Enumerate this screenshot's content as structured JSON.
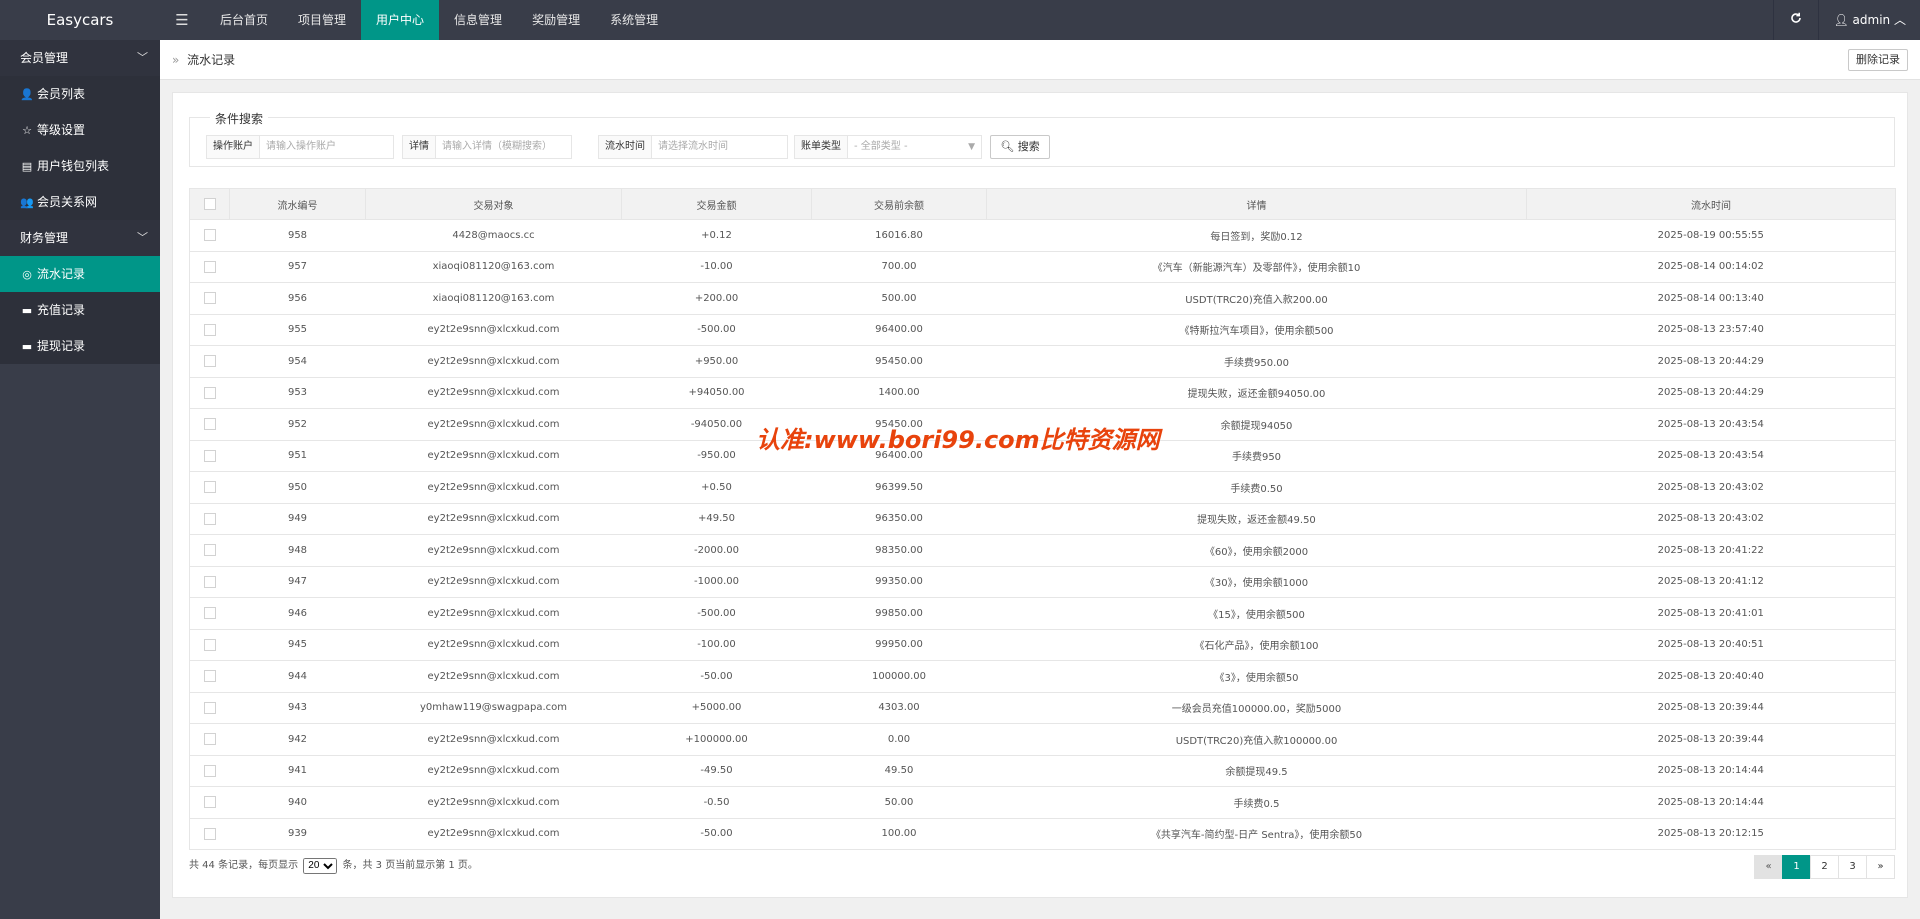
{
  "app": {
    "title": "Easycars",
    "menu_icon": "☰"
  },
  "topnav": {
    "items": [
      {
        "label": "后台首页",
        "active": false
      },
      {
        "label": "项目管理",
        "active": false
      },
      {
        "label": "用户中心",
        "active": true
      },
      {
        "label": "信息管理",
        "active": false
      },
      {
        "label": "奖励管理",
        "active": false
      },
      {
        "label": "系统管理",
        "active": false
      }
    ]
  },
  "topright": {
    "refresh_icon": "refresh-icon",
    "user": "admin"
  },
  "sidebar": {
    "group1": {
      "label": "会员管理"
    },
    "group1_items": [
      {
        "label": "会员列表",
        "icon": "👤"
      },
      {
        "label": "等级设置",
        "icon": "☆"
      },
      {
        "label": "用户钱包列表",
        "icon": "▤"
      },
      {
        "label": "会员关系网",
        "icon": "👥"
      }
    ],
    "group2": {
      "label": "财务管理"
    },
    "group2_items": [
      {
        "label": "流水记录",
        "icon": "◎",
        "active": true
      },
      {
        "label": "充值记录",
        "icon": "▬"
      },
      {
        "label": "提现记录",
        "icon": "▬"
      }
    ]
  },
  "breadcrumb": {
    "arrow": "»",
    "current": "流水记录"
  },
  "actions": {
    "delete_label": "删除记录"
  },
  "search": {
    "legend": "条件搜索",
    "account_label": "操作账户",
    "account_placeholder": "请输入操作账户",
    "detail_label": "详情",
    "detail_placeholder": "请输入详情（模糊搜索）",
    "time_label": "流水时间",
    "time_placeholder": "请选择流水时间",
    "type_label": "账单类型",
    "type_value": "- 全部类型 -",
    "button_label": "搜索"
  },
  "table": {
    "headers": [
      "流水编号",
      "交易对象",
      "交易金额",
      "交易前余额",
      "详情",
      "流水时间"
    ],
    "rows": [
      {
        "id": "958",
        "target": "4428@maocs.cc",
        "amount": "+0.12",
        "sign": "pos",
        "before": "16016.80",
        "detail": "每日签到，奖励0.12",
        "time": "2025-08-19 00:55:55"
      },
      {
        "id": "957",
        "target": "xiaoqi081120@163.com",
        "amount": "-10.00",
        "sign": "neg",
        "before": "700.00",
        "detail": "《汽车（新能源汽车）及零部件》，使用余额10",
        "time": "2025-08-14 00:14:02"
      },
      {
        "id": "956",
        "target": "xiaoqi081120@163.com",
        "amount": "+200.00",
        "sign": "pos",
        "before": "500.00",
        "detail": "USDT(TRC20)充值入款200.00",
        "time": "2025-08-14 00:13:40"
      },
      {
        "id": "955",
        "target": "ey2t2e9snn@xlcxkud.com",
        "amount": "-500.00",
        "sign": "neg",
        "before": "96400.00",
        "detail": "《特斯拉汽车项目》，使用余额500",
        "time": "2025-08-13 23:57:40"
      },
      {
        "id": "954",
        "target": "ey2t2e9snn@xlcxkud.com",
        "amount": "+950.00",
        "sign": "pos",
        "before": "95450.00",
        "detail": "手续费950.00",
        "time": "2025-08-13 20:44:29"
      },
      {
        "id": "953",
        "target": "ey2t2e9snn@xlcxkud.com",
        "amount": "+94050.00",
        "sign": "pos",
        "before": "1400.00",
        "detail": "提现失败，返还金额94050.00",
        "time": "2025-08-13 20:44:29"
      },
      {
        "id": "952",
        "target": "ey2t2e9snn@xlcxkud.com",
        "amount": "-94050.00",
        "sign": "neg",
        "before": "95450.00",
        "detail": "余额提现94050",
        "time": "2025-08-13 20:43:54"
      },
      {
        "id": "951",
        "target": "ey2t2e9snn@xlcxkud.com",
        "amount": "-950.00",
        "sign": "neg",
        "before": "96400.00",
        "detail": "手续费950",
        "time": "2025-08-13 20:43:54"
      },
      {
        "id": "950",
        "target": "ey2t2e9snn@xlcxkud.com",
        "amount": "+0.50",
        "sign": "pos",
        "before": "96399.50",
        "detail": "手续费0.50",
        "time": "2025-08-13 20:43:02"
      },
      {
        "id": "949",
        "target": "ey2t2e9snn@xlcxkud.com",
        "amount": "+49.50",
        "sign": "pos",
        "before": "96350.00",
        "detail": "提现失败，返还金额49.50",
        "time": "2025-08-13 20:43:02"
      },
      {
        "id": "948",
        "target": "ey2t2e9snn@xlcxkud.com",
        "amount": "-2000.00",
        "sign": "neg",
        "before": "98350.00",
        "detail": "《60》，使用余额2000",
        "time": "2025-08-13 20:41:22"
      },
      {
        "id": "947",
        "target": "ey2t2e9snn@xlcxkud.com",
        "amount": "-1000.00",
        "sign": "neg",
        "before": "99350.00",
        "detail": "《30》，使用余额1000",
        "time": "2025-08-13 20:41:12"
      },
      {
        "id": "946",
        "target": "ey2t2e9snn@xlcxkud.com",
        "amount": "-500.00",
        "sign": "neg",
        "before": "99850.00",
        "detail": "《15》，使用余额500",
        "time": "2025-08-13 20:41:01"
      },
      {
        "id": "945",
        "target": "ey2t2e9snn@xlcxkud.com",
        "amount": "-100.00",
        "sign": "neg",
        "before": "99950.00",
        "detail": "《石化产品》，使用余额100",
        "time": "2025-08-13 20:40:51"
      },
      {
        "id": "944",
        "target": "ey2t2e9snn@xlcxkud.com",
        "amount": "-50.00",
        "sign": "neg",
        "before": "100000.00",
        "detail": "《3》，使用余额50",
        "time": "2025-08-13 20:40:40"
      },
      {
        "id": "943",
        "target": "y0mhaw119@swagpapa.com",
        "amount": "+5000.00",
        "sign": "pos",
        "before": "4303.00",
        "detail": "一级会员充值100000.00，奖励5000",
        "time": "2025-08-13 20:39:44"
      },
      {
        "id": "942",
        "target": "ey2t2e9snn@xlcxkud.com",
        "amount": "+100000.00",
        "sign": "pos",
        "before": "0.00",
        "detail": "USDT(TRC20)充值入款100000.00",
        "time": "2025-08-13 20:39:44"
      },
      {
        "id": "941",
        "target": "ey2t2e9snn@xlcxkud.com",
        "amount": "-49.50",
        "sign": "neg",
        "before": "49.50",
        "detail": "余额提现49.5",
        "time": "2025-08-13 20:14:44"
      },
      {
        "id": "940",
        "target": "ey2t2e9snn@xlcxkud.com",
        "amount": "-0.50",
        "sign": "neg",
        "before": "50.00",
        "detail": "手续费0.5",
        "time": "2025-08-13 20:14:44"
      },
      {
        "id": "939",
        "target": "ey2t2e9snn@xlcxkud.com",
        "amount": "-50.00",
        "sign": "neg",
        "before": "100.00",
        "detail": "《共享汽车-简约型-日产 Sentra》，使用余额50",
        "time": "2025-08-13 20:12:15"
      }
    ]
  },
  "pagination": {
    "info_prefix": "共 44 条记录，每页显示",
    "page_size": "20",
    "info_suffix": "条，共 3 页当前显示第 1 页。",
    "prev": "«",
    "next": "»",
    "pages": [
      "1",
      "2",
      "3"
    ],
    "current": "1"
  },
  "watermark": "认准:www.bori99.com比特资源网",
  "colors": {
    "accent": "#009688",
    "topbar": "#393d49",
    "positive": "#0a9a15",
    "negative": "#e02020"
  }
}
